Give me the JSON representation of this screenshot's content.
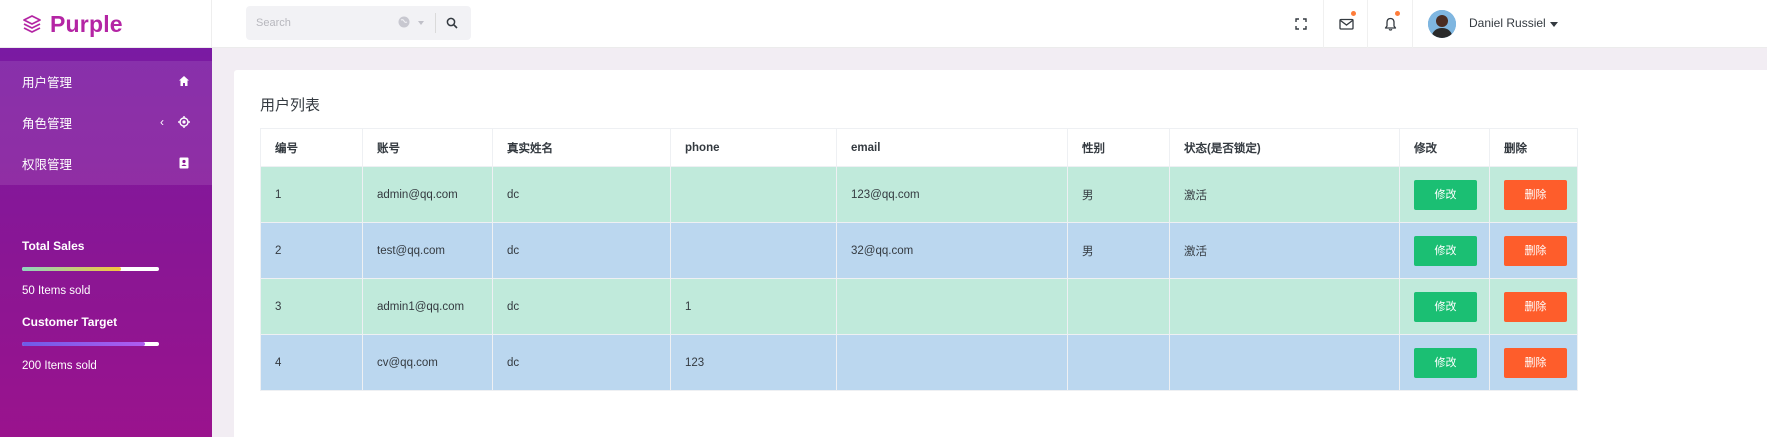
{
  "brand": {
    "name": "Purple",
    "color": "#b425a4"
  },
  "search": {
    "placeholder": "Search"
  },
  "user": {
    "name": "Daniel Russiel"
  },
  "header_icons": [
    "fullscreen-icon",
    "mail-icon",
    "bell-icon"
  ],
  "sidebar": {
    "items": [
      {
        "label": "用户管理",
        "icon": "home-icon"
      },
      {
        "label": "角色管理",
        "icon": "crosshair-icon",
        "chevron": "‹"
      },
      {
        "label": "权限管理",
        "icon": "contact-card-icon"
      }
    ],
    "stats": [
      {
        "title": "Total Sales",
        "progress": 0.72,
        "sub": "50 Items sold"
      },
      {
        "title": "Customer Target",
        "progress": 0.9,
        "sub": "200 Items sold"
      }
    ]
  },
  "main": {
    "title": "用户列表",
    "columns": [
      "编号",
      "账号",
      "真实姓名",
      "phone",
      "email",
      "性别",
      "状态(是否锁定)",
      "修改",
      "删除"
    ],
    "rows": [
      {
        "id": "1",
        "account": "admin@qq.com",
        "name": "dc",
        "phone": "",
        "email": "123@qq.com",
        "gender": "男",
        "status": "激活"
      },
      {
        "id": "2",
        "account": "test@qq.com",
        "name": "dc",
        "phone": "",
        "email": "32@qq.com",
        "gender": "男",
        "status": "激活"
      },
      {
        "id": "3",
        "account": "admin1@qq.com",
        "name": "dc",
        "phone": "1",
        "email": "",
        "gender": "",
        "status": ""
      },
      {
        "id": "4",
        "account": "cv@qq.com",
        "name": "dc",
        "phone": "123",
        "email": "",
        "gender": "",
        "status": ""
      }
    ],
    "edit_label": "修改",
    "delete_label": "删除"
  },
  "colors": {
    "row_green": "#c0eadb",
    "row_blue": "#bbd7ef",
    "edit_button": "#1bbf73",
    "delete_button": "#fe5d2b"
  }
}
